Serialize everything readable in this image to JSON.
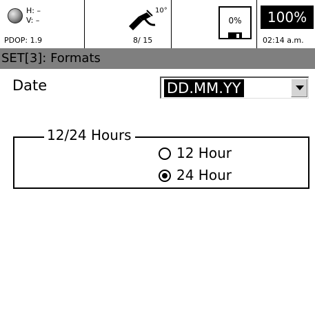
{
  "status": {
    "gps": {
      "h_label": "H: –",
      "v_label": "V: –",
      "pdop": "PDOP: 1.9"
    },
    "satellites": {
      "angle": "10°",
      "count": "8/ 15"
    },
    "storage": {
      "percent": "0%"
    },
    "battery": {
      "percent": "100%"
    },
    "time": "02:14 a.m."
  },
  "title": "SET[3]: Formats",
  "date_field": {
    "label": "Date",
    "value": "DD.MM.YY"
  },
  "hours_group": {
    "title": "12/24 Hours",
    "options": [
      {
        "label": "12 Hour",
        "selected": false
      },
      {
        "label": "24 Hour",
        "selected": true
      }
    ]
  }
}
